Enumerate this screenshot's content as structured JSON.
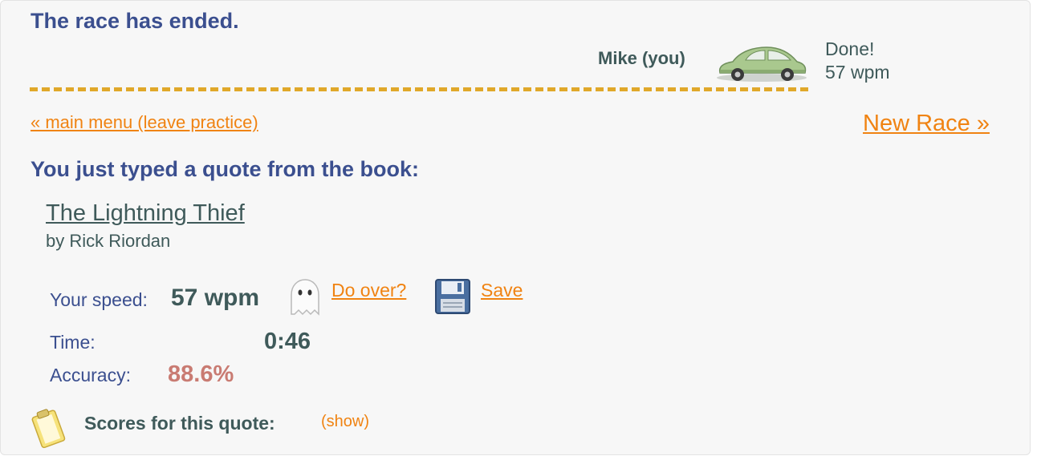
{
  "status": {
    "title": "The race has ended."
  },
  "racer": {
    "name": "Mike (you)",
    "car_color": "#a9c88e",
    "state": "Done!",
    "wpm": "57 wpm"
  },
  "nav": {
    "main_menu": "« main menu (leave practice)",
    "new_race": "New Race »"
  },
  "quote": {
    "heading": "You just typed a quote from the book:",
    "book_title": "The Lightning Thief",
    "author": "by Rick Riordan"
  },
  "results": {
    "speed_label": "Your speed:",
    "speed_value": "57 wpm",
    "do_over": "Do over?",
    "save": "Save",
    "time_label": "Time:",
    "time_value": "0:46",
    "accuracy_label": "Accuracy:",
    "accuracy_value": "88.6%"
  },
  "scores": {
    "label": "Scores for this quote:",
    "toggle": "(show)"
  },
  "colors": {
    "heading": "#3b4f8f",
    "link": "#f08312",
    "track": "#e0a82a",
    "accuracy": "#c97b72"
  },
  "icons": [
    "car-icon",
    "ghost-icon",
    "floppy-disk-icon",
    "clipboard-icon"
  ]
}
